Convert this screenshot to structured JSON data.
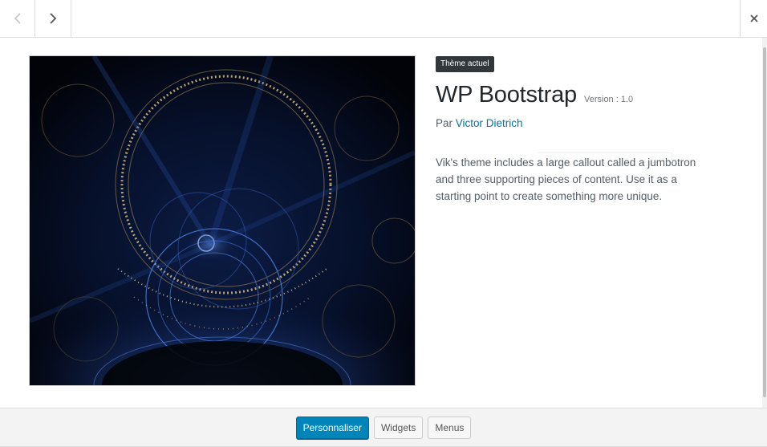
{
  "header": {
    "prev_icon": "chevron-left-icon",
    "next_icon": "chevron-right-icon",
    "close_icon": "close-icon"
  },
  "theme": {
    "badge": "Thème actuel",
    "name": "WP Bootstrap",
    "version": "Version : 1.0",
    "author_prefix": "Par",
    "author_name": "Victor Dietrich",
    "description": "Vik's theme includes a large callout called a jumbotron and three supporting pieces of content. Use it as a starting point to create something more unique."
  },
  "footer": {
    "customize_label": "Personnaliser",
    "widgets_label": "Widgets",
    "menus_label": "Menus"
  },
  "colors": {
    "primary_button": "#0085ba",
    "link": "#0073aa",
    "badge_bg": "#32373c"
  }
}
